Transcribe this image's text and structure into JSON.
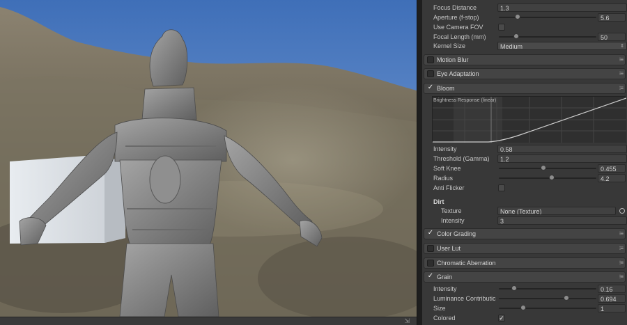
{
  "dof": {
    "focus_distance": {
      "label": "Focus Distance",
      "value": "1.3"
    },
    "aperture": {
      "label": "Aperture (f-stop)",
      "value": "5.6",
      "fraction": 0.19
    },
    "use_camera_fov": {
      "label": "Use Camera FOV",
      "checked": false
    },
    "focal_length": {
      "label": "Focal Length (mm)",
      "value": "50",
      "fraction": 0.18
    },
    "kernel_size": {
      "label": "Kernel Size",
      "value": "Medium"
    }
  },
  "sections": {
    "motion_blur": {
      "label": "Motion Blur",
      "enabled": false
    },
    "eye_adaptation": {
      "label": "Eye Adaptation",
      "enabled": false
    },
    "bloom": {
      "label": "Bloom",
      "enabled": true
    },
    "color_grading": {
      "label": "Color Grading",
      "enabled": true
    },
    "user_lut": {
      "label": "User Lut",
      "enabled": false
    },
    "chromatic_aberration": {
      "label": "Chromatic Aberration",
      "enabled": false
    },
    "grain": {
      "label": "Grain",
      "enabled": true
    }
  },
  "bloom": {
    "graph_title": "Brightness Response (linear)",
    "intensity": {
      "label": "Intensity",
      "value": "0.58"
    },
    "threshold": {
      "label": "Threshold (Gamma)",
      "value": "1.2"
    },
    "soft_knee": {
      "label": "Soft Knee",
      "value": "0.455",
      "fraction": 0.455
    },
    "radius": {
      "label": "Radius",
      "value": "4.2",
      "fraction": 0.54
    },
    "anti_flicker": {
      "label": "Anti Flicker",
      "checked": false
    },
    "dirt_heading": "Dirt",
    "dirt_texture": {
      "label": "Texture",
      "value": "None (Texture)"
    },
    "dirt_intensity": {
      "label": "Intensity",
      "value": "3"
    }
  },
  "grain": {
    "intensity": {
      "label": "Intensity",
      "value": "0.16",
      "fraction": 0.16
    },
    "luminance": {
      "label": "Luminance Contributic",
      "value": "0.694",
      "fraction": 0.694
    },
    "size": {
      "label": "Size",
      "value": "1",
      "fraction": 0.25
    },
    "colored": {
      "label": "Colored",
      "checked": true
    }
  },
  "icons": {
    "section_menu": "⁝≡",
    "dropdown_arrows": "⇕",
    "check": "✓"
  }
}
